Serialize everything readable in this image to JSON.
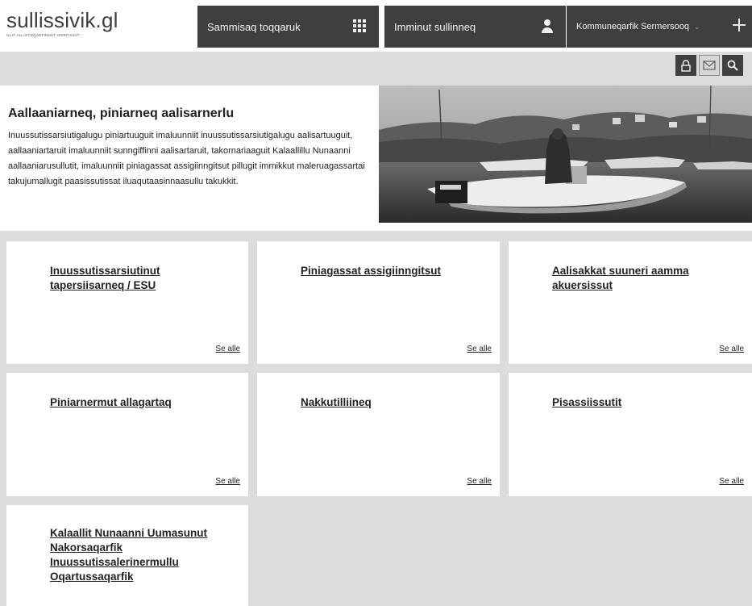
{
  "header": {
    "logo_text": "sullissivik.gl",
    "logo_tagline": "ILLIT ALLAFFEQARFINNUT ISERFISSAT",
    "nav_services": "Sammisaq toqqaruk",
    "nav_self_service": "Imminut sullinneq",
    "nav_municipality": "Kommuneqarfik Sermersooq",
    "icons": {
      "services": "grid-icon",
      "self_service": "user-icon",
      "municipality": "chevron-down-icon",
      "menu": "plus-icon"
    }
  },
  "utility": {
    "icons": [
      "lock-icon",
      "mail-icon",
      "search-icon"
    ]
  },
  "hero": {
    "title": "Aallaaniarneq, piniarneq aalisarnerlu",
    "body": "Inuussutissarsiutigalugu piniartuuguit imaluunniit inuussutissarsiutigalugu aalisartuuguit, aallaaniartaruit imaluunniit sunngiffinni aalisartaruit, takornariaaguit Kalaallillu Nunaanni aallaaniarusullutit, imaluunniit piniagassat assigiinngitsut pillugit immikkut maleruagassartai takujumallugit paasissutissat iluaqutaasinnaasullu takukkit.",
    "image": "fisherman-boat-photo"
  },
  "cards": [
    {
      "title": "Inuussutissarsiutinut tapersiisarneq / ESU",
      "link": "Se alle"
    },
    {
      "title": "Piniagassat assigiinngitsut",
      "link": "Se alle"
    },
    {
      "title": "Aalisakkat suuneri aamma akuersissut",
      "link": "Se alle"
    },
    {
      "title": "Piniarnermut allagartaq",
      "link": "Se alle"
    },
    {
      "title": "Nakkutilliineq",
      "link": "Se alle"
    },
    {
      "title": "Pisassiissutit",
      "link": "Se alle"
    },
    {
      "title": "Kalaallit Nunaanni Uumasunut Nakorsaqarfik Inuussutissalerinermullu Oqartussaqarfik"
    }
  ],
  "colors": {
    "nav_bg": "#3f3f3f",
    "gray_bg": "#dcdcdc",
    "text": "#222222"
  }
}
